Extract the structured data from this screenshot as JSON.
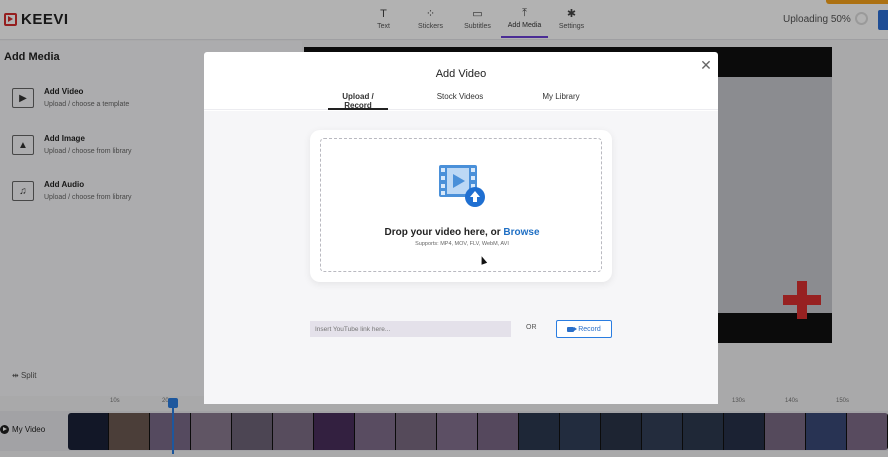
{
  "app": {
    "name": "KEEVI"
  },
  "nav": {
    "items": [
      {
        "label": "Text",
        "icon": "text-icon"
      },
      {
        "label": "Stickers",
        "icon": "stickers-icon"
      },
      {
        "label": "Subtitles",
        "icon": "subtitles-icon"
      },
      {
        "label": "Add Media",
        "icon": "upload-icon",
        "active": true
      },
      {
        "label": "Settings",
        "icon": "gear-icon"
      }
    ]
  },
  "status": {
    "uploading": "Uploading 50%"
  },
  "left_panel": {
    "title": "Add Media",
    "items": [
      {
        "title": "Add Video",
        "subtitle": "Upload / choose a template",
        "icon": "video-icon"
      },
      {
        "title": "Add Image",
        "subtitle": "Upload / choose from library",
        "icon": "image-icon"
      },
      {
        "title": "Add Audio",
        "subtitle": "Upload / choose from library",
        "icon": "music-icon"
      }
    ],
    "split_label": "Split"
  },
  "timeline": {
    "ticks": [
      "10s",
      "20s",
      "130s",
      "140s",
      "150s"
    ],
    "track_label": "My Video",
    "playhead_progress": 0.2
  },
  "modal": {
    "title": "Add Video",
    "tabs": [
      "Upload / Record",
      "Stock Videos",
      "My Library"
    ],
    "active_tab": 0,
    "drop_text": "Drop your video here, or ",
    "browse_label": "Browse",
    "supports": "Supports: MP4, MOV, FLV, WebM, AVI",
    "youtube_placeholder": "Insert YouTube link here...",
    "or_label": "OR",
    "record_label": "Record"
  },
  "colors": {
    "accent": "#6b3fd6",
    "link": "#1f6fc4",
    "primary_blue": "#2a7de1",
    "brand_red": "#d62b2b",
    "upload_orange": "#f7a21b"
  }
}
